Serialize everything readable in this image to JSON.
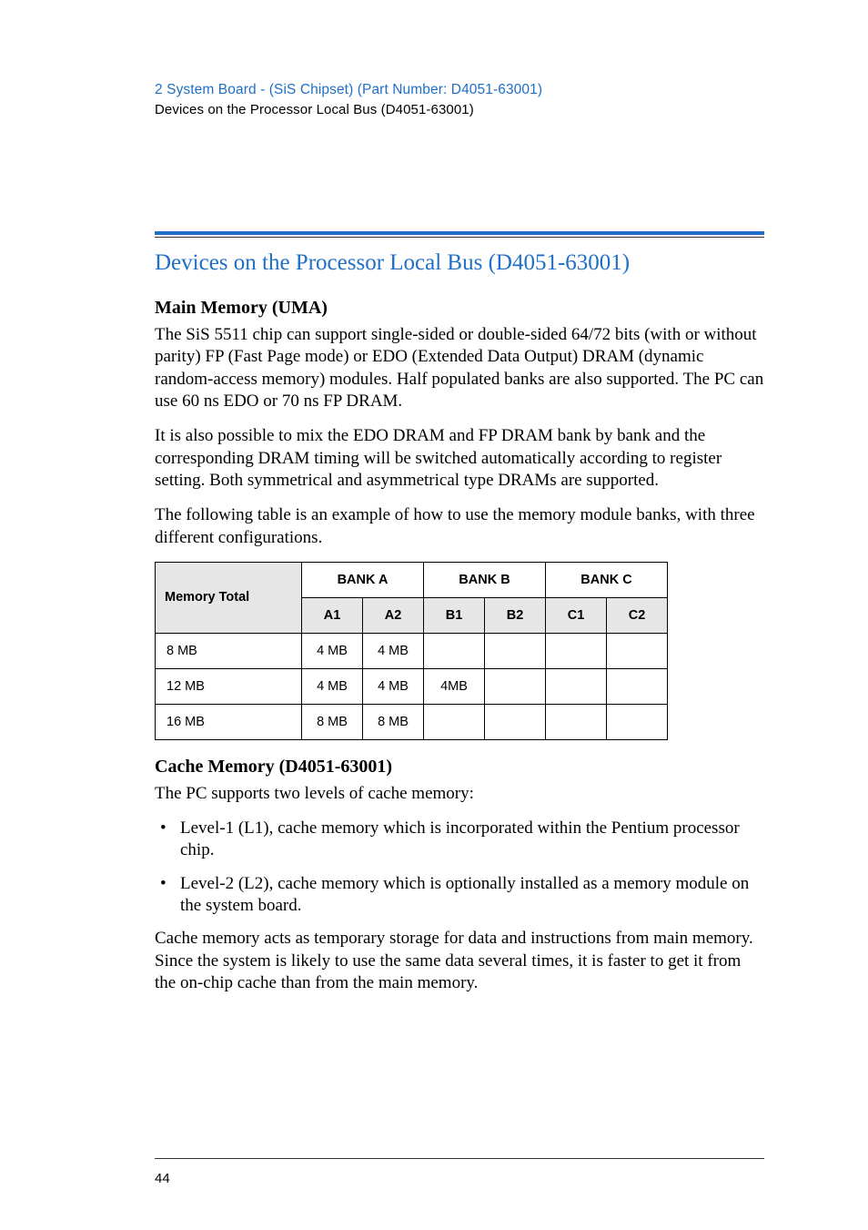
{
  "header": {
    "chapter": "2  System Board - (SiS Chipset) (Part Number: D4051-63001)",
    "sub": "Devices on the Processor Local Bus (D4051-63001)"
  },
  "section_title": "Devices on the Processor Local Bus (D4051-63001)",
  "main_memory": {
    "heading": "Main Memory (UMA)",
    "p1": "The SiS 5511 chip can support single-sided or double-sided 64/72 bits (with or without parity) FP (Fast Page mode) or EDO (Extended Data Output) DRAM (dynamic random-access memory) modules. Half populated banks are also supported. The PC can use 60 ns EDO or 70 ns FP DRAM.",
    "p2": "It is also possible to mix the EDO DRAM and FP DRAM bank by bank and the corresponding DRAM timing will be switched automatically according to register setting. Both symmetrical and asymmetrical type DRAMs are supported.",
    "p3": "The following table is an example of how to use the memory module banks, with three different configurations."
  },
  "table": {
    "bank_a": "BANK A",
    "bank_b": "BANK B",
    "bank_c": "BANK C",
    "row_head": "Memory Total",
    "cols": {
      "a1": "A1",
      "a2": "A2",
      "b1": "B1",
      "b2": "B2",
      "c1": "C1",
      "c2": "C2"
    },
    "rows": [
      {
        "label": "8 MB",
        "a1": "4 MB",
        "a2": "4 MB",
        "b1": "",
        "b2": "",
        "c1": "",
        "c2": ""
      },
      {
        "label": "12 MB",
        "a1": "4 MB",
        "a2": "4 MB",
        "b1": "4MB",
        "b2": "",
        "c1": "",
        "c2": ""
      },
      {
        "label": "16 MB",
        "a1": "8 MB",
        "a2": "8 MB",
        "b1": "",
        "b2": "",
        "c1": "",
        "c2": ""
      }
    ]
  },
  "cache": {
    "heading": "Cache Memory (D4051-63001)",
    "intro": "The PC supports two levels of cache memory:",
    "b1": "Level-1 (L1), cache memory which is incorporated within the Pentium processor chip.",
    "b2": "Level-2 (L2), cache memory which is optionally installed as a memory module on the system board.",
    "p_after": "Cache memory acts as temporary storage for data and instructions from main memory. Since the system is likely to use the same data several times, it is faster to get it from the on-chip cache than from the main memory."
  },
  "page_number": "44",
  "chart_data": {
    "type": "table",
    "title": "Memory module bank configurations",
    "columns": [
      "Memory Total",
      "A1",
      "A2",
      "B1",
      "B2",
      "C1",
      "C2"
    ],
    "rows": [
      [
        "8 MB",
        "4 MB",
        "4 MB",
        "",
        "",
        "",
        ""
      ],
      [
        "12 MB",
        "4 MB",
        "4 MB",
        "4MB",
        "",
        "",
        ""
      ],
      [
        "16 MB",
        "8 MB",
        "8 MB",
        "",
        "",
        "",
        ""
      ]
    ]
  }
}
